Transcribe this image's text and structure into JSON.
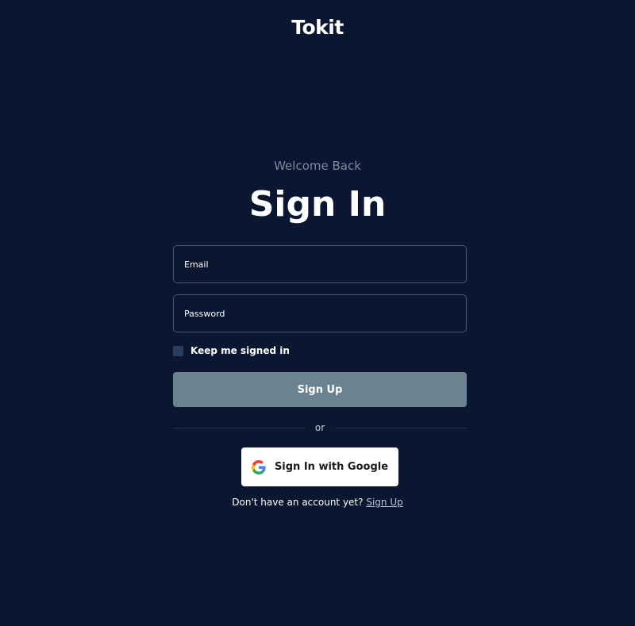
{
  "app": {
    "logo": "Tokit"
  },
  "header": {
    "subtitle": "Welcome Back",
    "title": "Sign In"
  },
  "form": {
    "email_placeholder": "Email",
    "email_value": "",
    "password_placeholder": "Password",
    "password_value": "",
    "remember_label": "Keep me signed in",
    "remember_checked": false,
    "submit_label": "Sign Up"
  },
  "divider": {
    "label": "or"
  },
  "google": {
    "label": "Sign In with Google",
    "icon": "google-g-icon"
  },
  "footer": {
    "prompt": "Don't have an account yet?",
    "link": "Sign Up"
  },
  "colors": {
    "background": "#0b1730",
    "primary_button": "#6b8290",
    "subtitle": "#7e8aa0",
    "field_border": "#4c5873",
    "checkbox": "#2a3d5e"
  }
}
